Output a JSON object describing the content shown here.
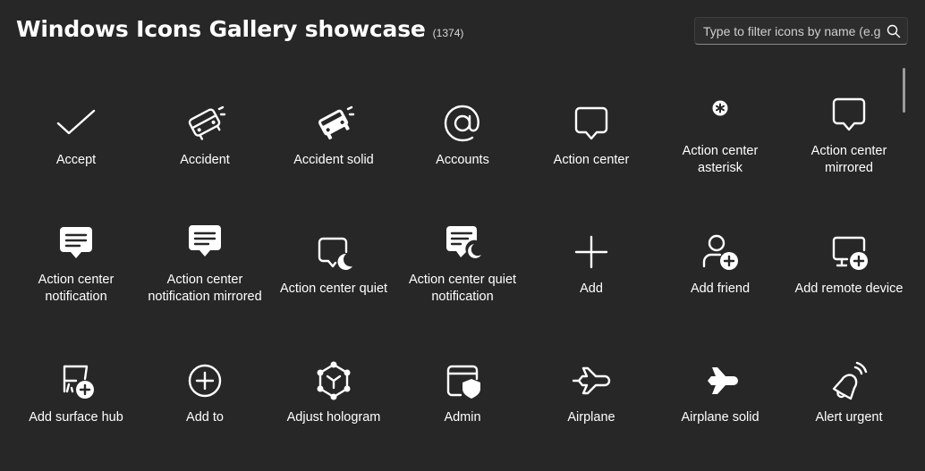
{
  "header": {
    "title": "Windows Icons Gallery showcase",
    "count": "(1374)"
  },
  "search": {
    "placeholder": "Type to filter icons by name (e.g. 'arrow')",
    "icon": "search-icon"
  },
  "icons": [
    {
      "label": "Accept",
      "icon": "accept-icon"
    },
    {
      "label": "Accident",
      "icon": "accident-icon"
    },
    {
      "label": "Accident solid",
      "icon": "accident-solid-icon"
    },
    {
      "label": "Accounts",
      "icon": "accounts-icon"
    },
    {
      "label": "Action center",
      "icon": "action-center-icon"
    },
    {
      "label": "Action center asterisk",
      "icon": "action-center-asterisk-icon"
    },
    {
      "label": "Action center mirrored",
      "icon": "action-center-mirrored-icon"
    },
    {
      "label": "Action center notification",
      "icon": "action-center-notification-icon"
    },
    {
      "label": "Action center notification mirrored",
      "icon": "action-center-notification-mirrored-icon"
    },
    {
      "label": "Action center quiet",
      "icon": "action-center-quiet-icon"
    },
    {
      "label": "Action center quiet notification",
      "icon": "action-center-quiet-notification-icon"
    },
    {
      "label": "Add",
      "icon": "add-icon"
    },
    {
      "label": "Add friend",
      "icon": "add-friend-icon"
    },
    {
      "label": "Add remote device",
      "icon": "add-remote-device-icon"
    },
    {
      "label": "Add surface hub",
      "icon": "add-surface-hub-icon"
    },
    {
      "label": "Add to",
      "icon": "add-to-icon"
    },
    {
      "label": "Adjust hologram",
      "icon": "adjust-hologram-icon"
    },
    {
      "label": "Admin",
      "icon": "admin-icon"
    },
    {
      "label": "Airplane",
      "icon": "airplane-icon"
    },
    {
      "label": "Airplane solid",
      "icon": "airplane-solid-icon"
    },
    {
      "label": "Alert urgent",
      "icon": "alert-urgent-icon"
    }
  ]
}
